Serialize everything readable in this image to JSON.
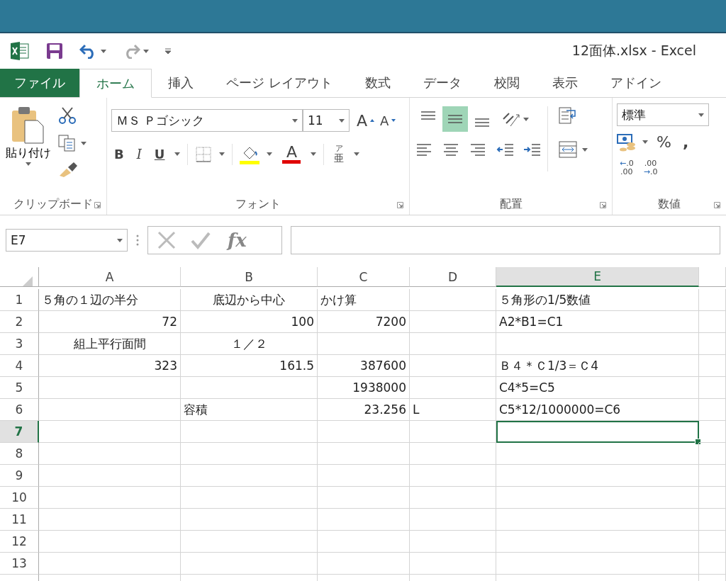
{
  "window": {
    "title": "12面体.xlsx - Excel"
  },
  "tabs": [
    {
      "label": "ファイル",
      "kind": "file",
      "selected": false
    },
    {
      "label": "ホーム",
      "kind": "tab",
      "selected": true
    },
    {
      "label": "挿入",
      "kind": "tab",
      "selected": false
    },
    {
      "label": "ページ レイアウト",
      "kind": "tab",
      "selected": false
    },
    {
      "label": "数式",
      "kind": "tab",
      "selected": false
    },
    {
      "label": "データ",
      "kind": "tab",
      "selected": false
    },
    {
      "label": "校閲",
      "kind": "tab",
      "selected": false
    },
    {
      "label": "表示",
      "kind": "tab",
      "selected": false
    },
    {
      "label": "アドイン",
      "kind": "tab",
      "selected": false
    }
  ],
  "ribbon": {
    "clipboard": {
      "paste_label": "貼り付け",
      "group_label": "クリップボード"
    },
    "font": {
      "name": "ＭＳ Ｐゴシック",
      "size": "11",
      "grow": "A",
      "shrink": "A",
      "bold": "B",
      "italic": "I",
      "underline": "U",
      "font_color": "A",
      "phonetic": [
        "ア",
        "亜"
      ],
      "group_label": "フォント"
    },
    "alignment": {
      "vertical": [
        {
          "kind": "top",
          "selected": false
        },
        {
          "kind": "middle",
          "selected": true
        },
        {
          "kind": "bottom",
          "selected": false
        }
      ],
      "group_label": "配置"
    },
    "number": {
      "format": "標準",
      "percent": "%",
      "comma": ",",
      "increase_decimal": [
        "←",
        ".0",
        ".00"
      ],
      "decrease_decimal": [
        ".00",
        "→",
        ".0"
      ],
      "group_label": "数値"
    }
  },
  "formula_bar": {
    "name_box": "E7",
    "fx": "fx"
  },
  "sheet": {
    "columns": [
      {
        "label": "A",
        "selected": false
      },
      {
        "label": "B",
        "selected": false
      },
      {
        "label": "C",
        "selected": false
      },
      {
        "label": "D",
        "selected": false
      },
      {
        "label": "E",
        "selected": true
      }
    ],
    "rows": [
      {
        "number": "1",
        "selected": false,
        "cells": [
          {
            "text": "５角の１辺の半分",
            "kind": "text"
          },
          {
            "text": "底辺から中心",
            "kind": "centered"
          },
          {
            "text": "かけ算",
            "kind": "text"
          },
          null,
          {
            "text": "５角形の1/5数値",
            "kind": "text"
          }
        ]
      },
      {
        "number": "2",
        "selected": false,
        "cells": [
          {
            "text": "72",
            "kind": "number"
          },
          {
            "text": "100",
            "kind": "number"
          },
          {
            "text": "7200",
            "kind": "number"
          },
          null,
          {
            "text": "A2*B1=C1",
            "kind": "text"
          }
        ]
      },
      {
        "number": "3",
        "selected": false,
        "cells": [
          {
            "text": "組上平行面間",
            "kind": "centered"
          },
          {
            "text": "１／２",
            "kind": "centered"
          },
          null,
          null,
          null
        ]
      },
      {
        "number": "4",
        "selected": false,
        "cells": [
          {
            "text": "323",
            "kind": "number"
          },
          {
            "text": "161.5",
            "kind": "number"
          },
          {
            "text": "387600",
            "kind": "number"
          },
          null,
          {
            "text": "Ｂ４＊Ｃ1/3＝Ｃ4",
            "kind": "text"
          }
        ]
      },
      {
        "number": "5",
        "selected": false,
        "cells": [
          null,
          null,
          {
            "text": "1938000",
            "kind": "number"
          },
          null,
          {
            "text": "C4*5=C5",
            "kind": "text"
          }
        ]
      },
      {
        "number": "6",
        "selected": false,
        "cells": [
          null,
          {
            "text": "容積",
            "kind": "text"
          },
          {
            "text": "23.256",
            "kind": "number"
          },
          {
            "text": "L",
            "kind": "text"
          },
          {
            "text": "C5*12/1000000=C6",
            "kind": "text"
          }
        ]
      },
      {
        "number": "7",
        "selected": true,
        "cells": [
          null,
          null,
          null,
          null,
          {
            "kind": "active"
          }
        ]
      },
      {
        "number": "8",
        "selected": false,
        "cells": [
          null,
          null,
          null,
          null,
          null
        ]
      },
      {
        "number": "9",
        "selected": false,
        "cells": [
          null,
          null,
          null,
          null,
          null
        ]
      },
      {
        "number": "10",
        "selected": false,
        "cells": [
          null,
          null,
          null,
          null,
          null
        ]
      },
      {
        "number": "11",
        "selected": false,
        "cells": [
          null,
          null,
          null,
          null,
          null
        ]
      },
      {
        "number": "12",
        "selected": false,
        "cells": [
          null,
          null,
          null,
          null,
          null
        ]
      },
      {
        "number": "13",
        "selected": false,
        "cells": [
          null,
          null,
          null,
          null,
          null
        ]
      }
    ]
  }
}
